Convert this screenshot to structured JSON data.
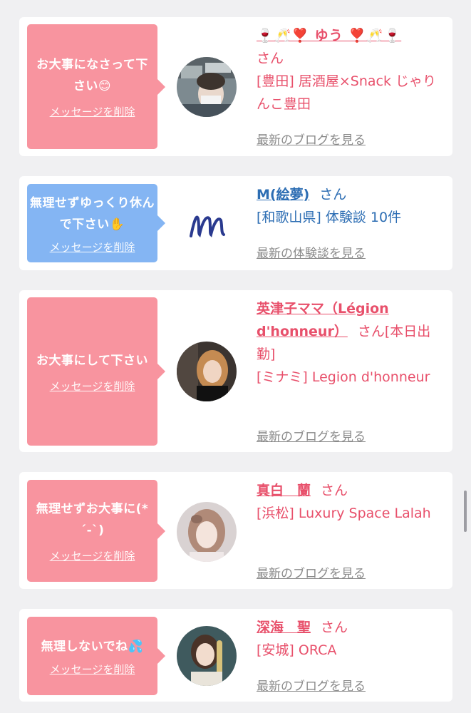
{
  "cards": [
    {
      "message": "お大事になさって下さい😊",
      "delete_label": "メッセージを削除",
      "name": "🍷🥂❣️ ゆう ❣️🥂🍷",
      "san": "さん",
      "shop": "[豊田] 居酒屋×Snack じゃりんこ豊田",
      "link": "最新のブログを見る"
    },
    {
      "message": "無理せずゆっくり休んで下さい✋",
      "delete_label": "メッセージを削除",
      "name": "M(絵夢)",
      "san": "さん",
      "shop": "[和歌山県] 体験談 10件",
      "link": "最新の体験談を見る"
    },
    {
      "message": "お大事にして下さい",
      "delete_label": "メッセージを削除",
      "name": "英津子ママ（Légion d'honneur）",
      "san": "さん[本日出勤]",
      "shop": "[ミナミ] Legion d'honneur",
      "link": "最新のブログを見る"
    },
    {
      "message": "無理せずお大事に(*´-`)",
      "delete_label": "メッセージを削除",
      "name": "真白　蘭",
      "san": "さん",
      "shop": "[浜松] Luxury Space Lalah",
      "link": "最新のブログを見る"
    },
    {
      "message": "無理しないでね💦",
      "delete_label": "メッセージを削除",
      "name": "深海　聖",
      "san": "さん",
      "shop": "[安城] ORCA",
      "link": "最新のブログを見る"
    }
  ],
  "colors": {
    "pink": "#f8949f",
    "blue": "#84b5f3",
    "name_pink": "#e8506b",
    "name_blue": "#2c6db3",
    "link_gray": "#8a8a8a"
  },
  "icons": [
    "user-photo",
    "m-logo",
    "user-photo",
    "user-photo",
    "user-photo"
  ]
}
